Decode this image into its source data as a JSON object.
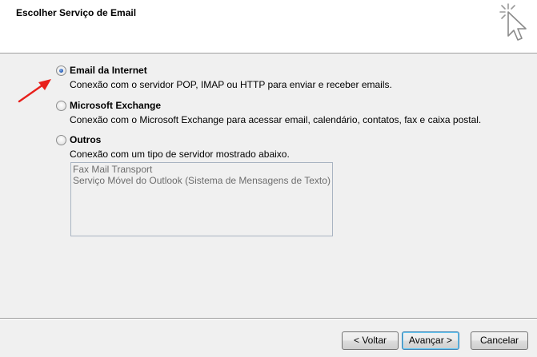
{
  "header": {
    "title": "Escolher Serviço de Email"
  },
  "options": [
    {
      "label": "Email da Internet",
      "description": "Conexão com o servidor POP, IMAP ou HTTP para enviar e receber emails.",
      "selected": true
    },
    {
      "label": "Microsoft Exchange",
      "description": "Conexão com o Microsoft Exchange para acessar email, calendário, contatos, fax e caixa postal.",
      "selected": false
    },
    {
      "label": "Outros",
      "description": "Conexão com um tipo de servidor mostrado abaixo.",
      "selected": false
    }
  ],
  "other_services": [
    "Fax Mail Transport",
    "Serviço Móvel do Outlook (Sistema de Mensagens de Texto)"
  ],
  "footer": {
    "back_label": "< Voltar",
    "next_label": "Avançar >",
    "cancel_label": "Cancelar"
  },
  "colors": {
    "annotation_arrow": "#e8201c",
    "header_bg": "#ffffff",
    "dialog_bg": "#f0f0f0",
    "disabled_text": "#6d6d6d"
  }
}
